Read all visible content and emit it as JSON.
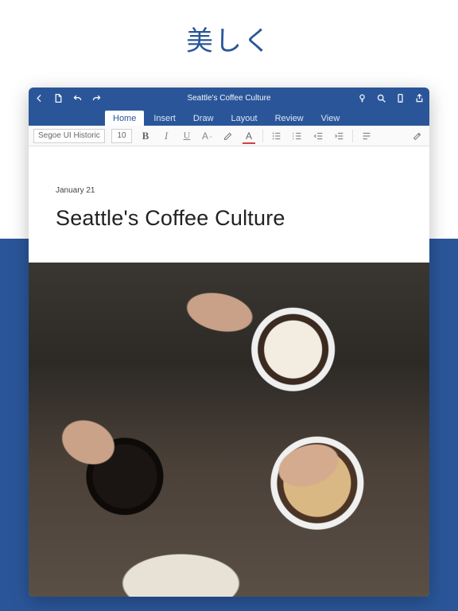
{
  "promo": {
    "tagline": "美しく"
  },
  "titlebar": {
    "document_title": "Seattle's Coffee Culture"
  },
  "ribbon": {
    "tabs": [
      {
        "label": "Home",
        "active": true
      },
      {
        "label": "Insert",
        "active": false
      },
      {
        "label": "Draw",
        "active": false
      },
      {
        "label": "Layout",
        "active": false
      },
      {
        "label": "Review",
        "active": false
      },
      {
        "label": "View",
        "active": false
      }
    ]
  },
  "toolbar": {
    "font_name": "Segoe UI Historic",
    "font_size": "10",
    "bold": "B",
    "italic": "I",
    "underline": "U",
    "font_format": "A",
    "font_color": "A"
  },
  "document": {
    "date": "January 21",
    "title": "Seattle's Coffee Culture"
  }
}
